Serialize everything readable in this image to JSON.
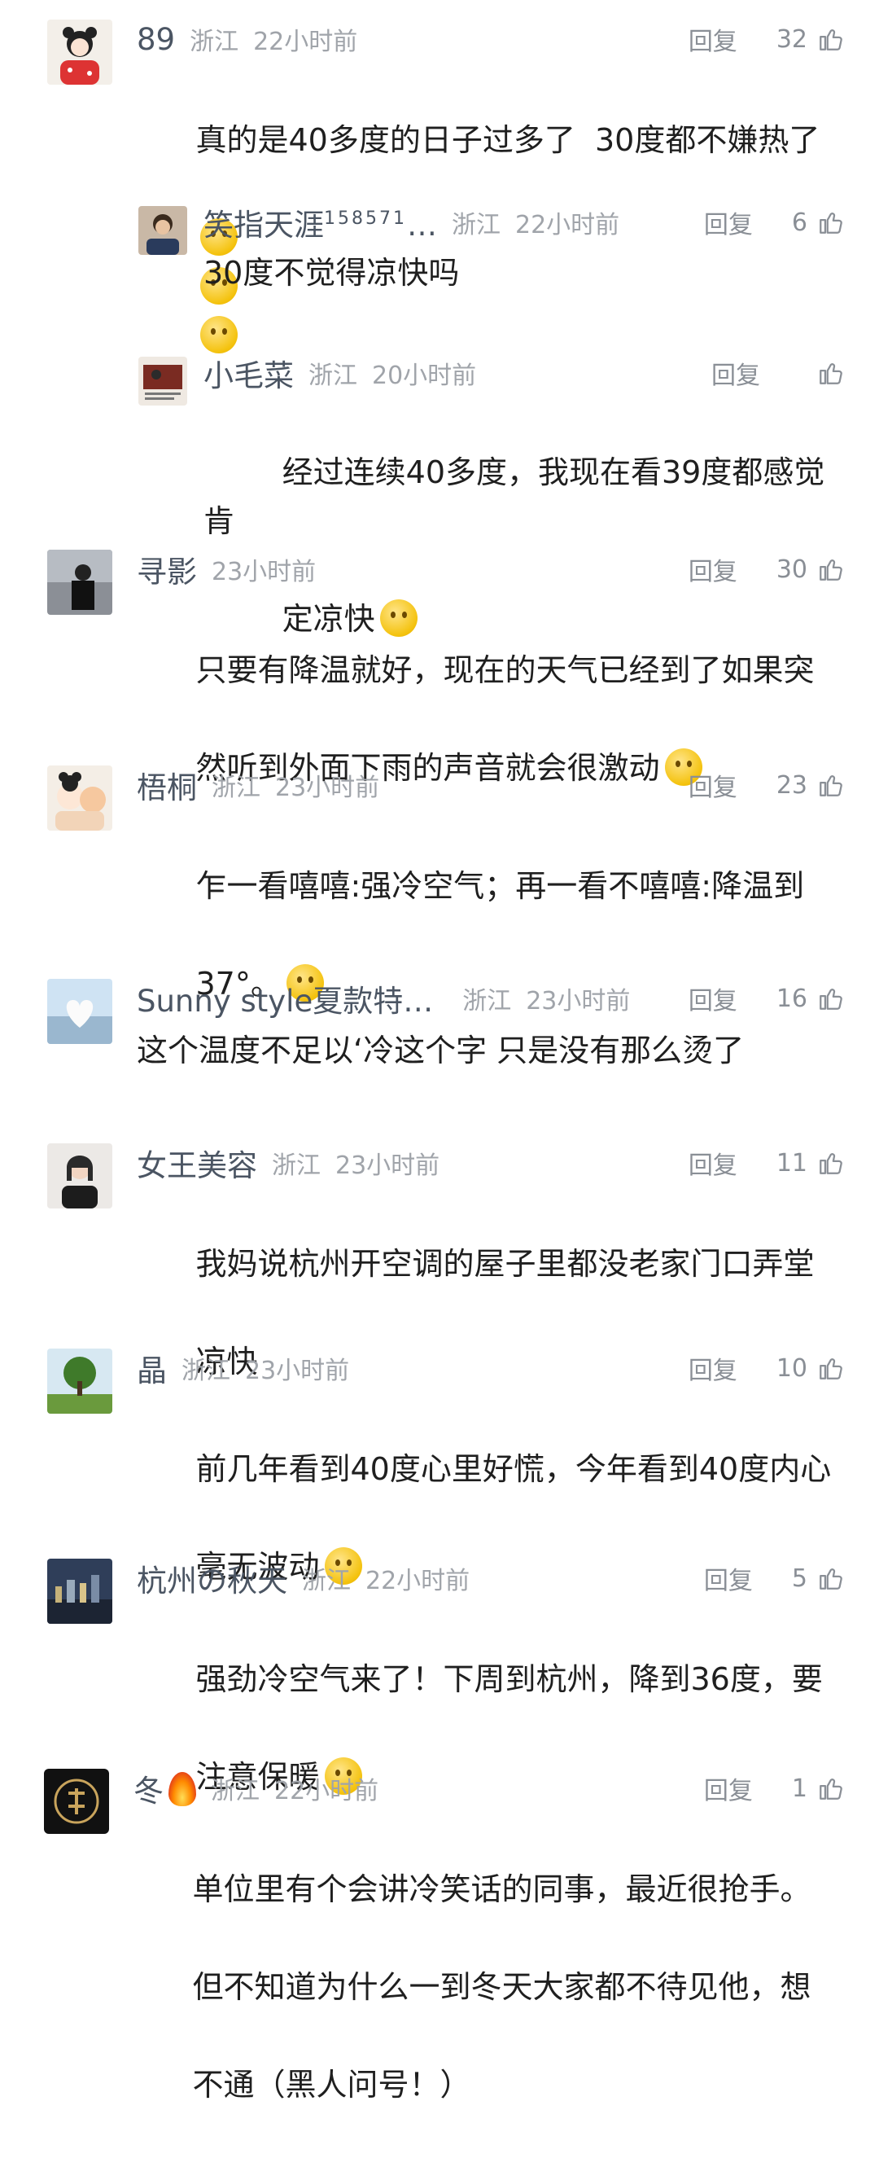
{
  "comments": [
    {
      "name": "89",
      "region": "浙江",
      "time": "22小时前",
      "reply": "回复",
      "likes": "32",
      "text": "真的是40多度的日子过多了  30度都不嫌热了",
      "emoji_count": 3,
      "replies": [
        {
          "name": "笑指天涯",
          "name_sup": "158571",
          "name_more": "…",
          "region": "浙江",
          "time": "22小时前",
          "reply": "回复",
          "likes": "6",
          "text": "30度不觉得凉快吗"
        },
        {
          "name": "小毛菜",
          "region": "浙江",
          "time": "20小时前",
          "reply": "回复",
          "likes": "",
          "text_line1": "经过连续40多度，我现在看39度都感觉肯",
          "text_line2": "定凉快"
        }
      ]
    },
    {
      "name": "寻影",
      "time": "23小时前",
      "reply": "回复",
      "likes": "30",
      "text_line1": "只要有降温就好，现在的天气已经到了如果突",
      "text_line2": "然听到外面下雨的声音就会很激动"
    },
    {
      "name": "梧桐",
      "region": "浙江",
      "time": "23小时前",
      "reply": "回复",
      "likes": "23",
      "text_line1": "乍一看嘻嘻:强冷空气；再一看不嘻嘻:降温到",
      "text_line2": "37°。"
    },
    {
      "name": "Sunny style夏款特…",
      "region": "浙江",
      "time": "23小时前",
      "reply": "回复",
      "likes": "16",
      "text": "这个温度不足以‘冷这个字 只是没有那么烫了"
    },
    {
      "name": "女王美容",
      "region": "浙江",
      "time": "23小时前",
      "reply": "回复",
      "likes": "11",
      "text_line1": "我妈说杭州开空调的屋子里都没老家门口弄堂",
      "text_line2": "凉快"
    },
    {
      "name": "晶",
      "region": "浙江",
      "time": "23小时前",
      "reply": "回复",
      "likes": "10",
      "text_line1": "前几年看到40度心里好慌，今年看到40度内心",
      "text_line2": "毫无波动"
    },
    {
      "name": "杭州の秋天",
      "region": "浙江",
      "time": "22小时前",
      "reply": "回复",
      "likes": "5",
      "text_line1": "强劲冷空气来了！下周到杭州，降到36度，要",
      "text_line2": "注意保暖"
    },
    {
      "name": "冬",
      "region": "浙江",
      "time": "22小时前",
      "reply": "回复",
      "likes": "1",
      "text_line1": "单位里有个会讲冷笑话的同事，最近很抢手。",
      "text_line2": "但不知道为什么一到冬天大家都不待见他，想",
      "text_line3": "不通（黑人问号！）"
    }
  ],
  "icons": {
    "like": "thumbs-up-icon",
    "emoji_cry": "crying-face-emoji",
    "emoji_smile": "smiling-face-emoji",
    "emoji_grin": "grinning-face-emoji",
    "emoji_shock": "shocked-face-emoji",
    "fire": "fire-emoji"
  }
}
